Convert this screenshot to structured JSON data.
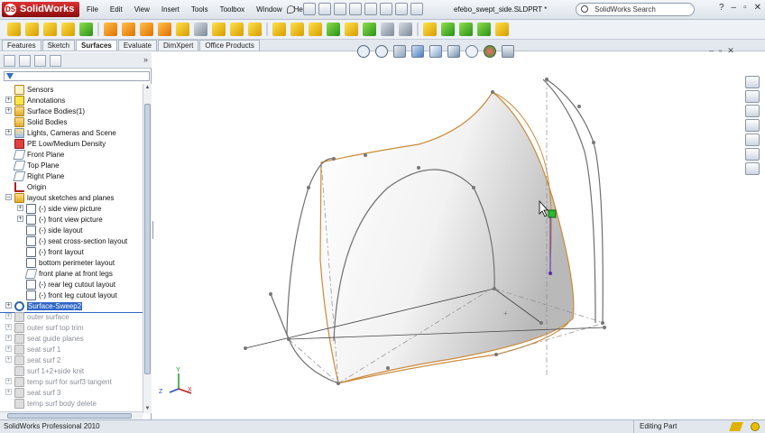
{
  "app": {
    "name": "SolidWorks",
    "document": "efebo_swept_side.SLDPRT *"
  },
  "menu": [
    "File",
    "Edit",
    "View",
    "Insert",
    "Tools",
    "Toolbox",
    "Window",
    "Help"
  ],
  "search": {
    "label": "SolidWorks Search"
  },
  "command_tabs": [
    "Features",
    "Sketch",
    "Surfaces",
    "Evaluate",
    "DimXpert",
    "Office Products"
  ],
  "active_tab": "Surfaces",
  "tree": {
    "items": [
      {
        "label": "Sensors",
        "icon": "sensor-icon",
        "state": "normal"
      },
      {
        "label": "Annotations",
        "icon": "annotations-icon",
        "state": "normal"
      },
      {
        "label": "Surface Bodies(1)",
        "icon": "surface-bodies-icon",
        "state": "normal"
      },
      {
        "label": "Solid Bodies",
        "icon": "solid-bodies-icon",
        "state": "normal"
      },
      {
        "label": "Lights, Cameras and Scene",
        "icon": "lights-icon",
        "state": "normal"
      },
      {
        "label": "PE Low/Medium Density",
        "icon": "material-icon",
        "state": "normal"
      },
      {
        "label": "Front Plane",
        "icon": "plane-icon",
        "state": "normal"
      },
      {
        "label": "Top Plane",
        "icon": "plane-icon",
        "state": "normal"
      },
      {
        "label": "Right Plane",
        "icon": "plane-icon",
        "state": "normal"
      },
      {
        "label": "Origin",
        "icon": "origin-icon",
        "state": "normal"
      },
      {
        "label": "layout sketches and planes",
        "icon": "folder-icon",
        "state": "normal"
      },
      {
        "label": "(-) side view picture",
        "icon": "sketch-icon",
        "state": "normal"
      },
      {
        "label": "(-) front view picture",
        "icon": "sketch-icon",
        "state": "normal"
      },
      {
        "label": "(-) side layout",
        "icon": "sketch-icon",
        "state": "normal"
      },
      {
        "label": "(-) seat cross-section layout",
        "icon": "sketch-icon",
        "state": "normal"
      },
      {
        "label": "(-) front layout",
        "icon": "sketch-icon",
        "state": "normal"
      },
      {
        "label": "bottom perimeter layout",
        "icon": "sketch-icon",
        "state": "normal"
      },
      {
        "label": "front plane at front legs",
        "icon": "plane-icon",
        "state": "normal"
      },
      {
        "label": "(-) rear leg cutout layout",
        "icon": "sketch-icon",
        "state": "normal"
      },
      {
        "label": "(-) front leg cutout layout",
        "icon": "sketch-icon",
        "state": "normal"
      },
      {
        "label": "Surface-Sweep2",
        "icon": "sweep-icon",
        "state": "selected"
      },
      {
        "label": "outer surface",
        "icon": "surface-icon",
        "state": "suppressed"
      },
      {
        "label": "outer surf top trim",
        "icon": "surface-icon",
        "state": "suppressed"
      },
      {
        "label": "seat guide planes",
        "icon": "folder-icon",
        "state": "suppressed"
      },
      {
        "label": "seat surf 1",
        "icon": "surface-icon",
        "state": "suppressed"
      },
      {
        "label": "seat surf 2",
        "icon": "surface-icon",
        "state": "suppressed"
      },
      {
        "label": "surf 1+2+side knit",
        "icon": "knit-icon",
        "state": "suppressed"
      },
      {
        "label": "temp surf for surf3 tangent",
        "icon": "surface-icon",
        "state": "suppressed"
      },
      {
        "label": "seat surf 3",
        "icon": "surface-icon",
        "state": "suppressed"
      },
      {
        "label": "temp surf body delete",
        "icon": "surface-icon",
        "state": "suppressed"
      }
    ]
  },
  "status": {
    "product": "SolidWorks Professional 2010",
    "mode": "Editing Part"
  },
  "triad": {
    "x": "X",
    "y": "Y",
    "z": "Z"
  },
  "colors": {
    "edge": "#c98a3a",
    "sketch": "#6e6e6e",
    "selection": "#2f66c6",
    "brand": "#c41e1e"
  }
}
